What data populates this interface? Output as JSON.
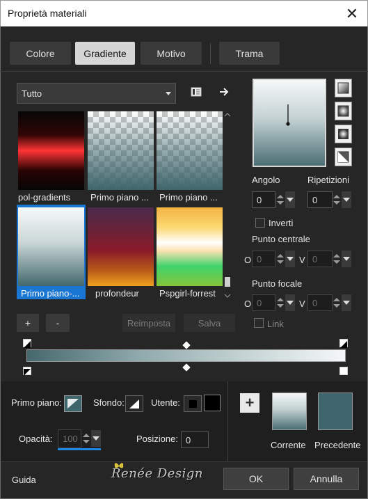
{
  "window": {
    "title": "Proprietà materiali",
    "close_glyph": "✕"
  },
  "tabs": [
    {
      "label": "Colore",
      "active": false
    },
    {
      "label": "Gradiente",
      "active": true
    },
    {
      "label": "Motivo",
      "active": false
    },
    {
      "label": "Trama",
      "active": false
    }
  ],
  "category": {
    "selected": "Tutto"
  },
  "gradients": [
    {
      "label": "pol-gradients",
      "selected": false
    },
    {
      "label": "Primo piano ...",
      "selected": false
    },
    {
      "label": "Primo piano ...",
      "selected": false
    },
    {
      "label": "Primo piano-...",
      "selected": true
    },
    {
      "label": "profondeur",
      "selected": false
    },
    {
      "label": "Pspgirl-forrest",
      "selected": false
    }
  ],
  "list_buttons": {
    "add": "+",
    "remove": "-",
    "reset": "Reimposta",
    "save": "Salva"
  },
  "angle": {
    "label": "Angolo",
    "value": "0"
  },
  "repeats": {
    "label": "Ripetizioni",
    "value": "0"
  },
  "invert": {
    "label": "Inverti",
    "checked": false
  },
  "center_point": {
    "label": "Punto centrale",
    "o_label": "O",
    "o_value": "0",
    "v_label": "V",
    "v_value": "0"
  },
  "focal_point": {
    "label": "Punto focale",
    "o_label": "O",
    "o_value": "0",
    "v_label": "V",
    "v_value": "0"
  },
  "link": {
    "label": "Link",
    "checked": false
  },
  "bottom": {
    "foreground_label": "Primo piano:",
    "background_label": "Sfondo:",
    "user_label": "Utente:",
    "opacity_label": "Opacità:",
    "opacity_value": "100",
    "position_label": "Posizione:",
    "position_value": "0",
    "add_glyph": "+",
    "current_label": "Corrente",
    "previous_label": "Precedente"
  },
  "footer": {
    "help": "Guida",
    "ok": "OK",
    "cancel": "Annulla",
    "logo": "Renée Design"
  },
  "colors": {
    "accent": "#1976d2",
    "teal": "#3f666c",
    "panel": "#262626"
  }
}
